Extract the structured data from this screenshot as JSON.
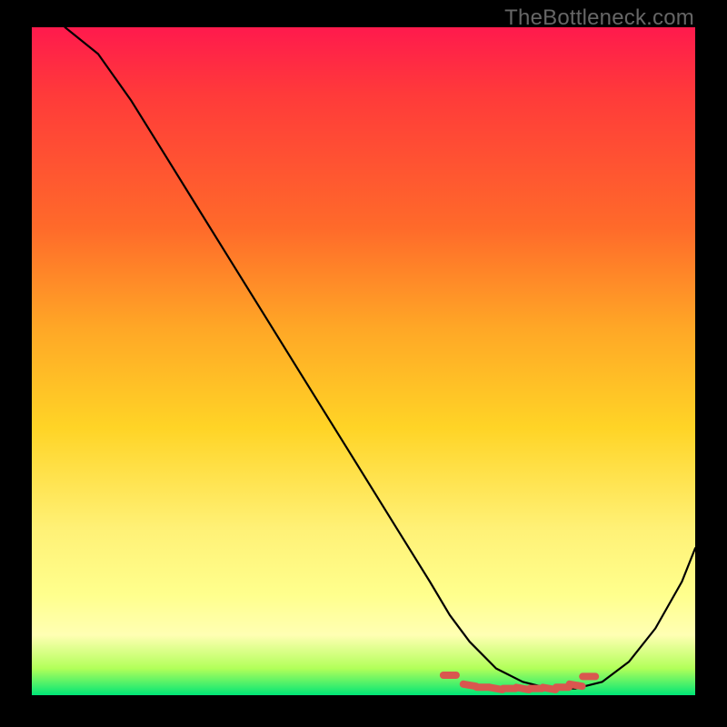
{
  "attribution": "TheBottleneck.com",
  "chart_data": {
    "type": "line",
    "title": "",
    "xlabel": "",
    "ylabel": "",
    "xlim": [
      0,
      100
    ],
    "ylim": [
      0,
      100
    ],
    "series": [
      {
        "name": "curve",
        "x": [
          5,
          10,
          15,
          20,
          25,
          30,
          35,
          40,
          45,
          50,
          55,
          60,
          63,
          66,
          70,
          74,
          78,
          82,
          86,
          90,
          94,
          98,
          100
        ],
        "values": [
          100,
          96,
          89,
          81,
          73,
          65,
          57,
          49,
          41,
          33,
          25,
          17,
          12,
          8,
          4,
          2,
          1,
          1,
          2,
          5,
          10,
          17,
          22
        ]
      }
    ],
    "markers": {
      "name": "dotted-bottom",
      "color": "#d9574f",
      "x": [
        63,
        66,
        68,
        70,
        72,
        74,
        76,
        78,
        80,
        82,
        84
      ],
      "values": [
        3,
        1.5,
        1.2,
        1,
        1,
        1,
        1,
        1,
        1.2,
        1.5,
        2.8
      ]
    }
  },
  "colors": {
    "curve": "#000000",
    "markers": "#d9574f",
    "background_top": "#ff1a4d",
    "background_bottom": "#00e676",
    "frame": "#000000",
    "attribution_text": "#666666"
  }
}
